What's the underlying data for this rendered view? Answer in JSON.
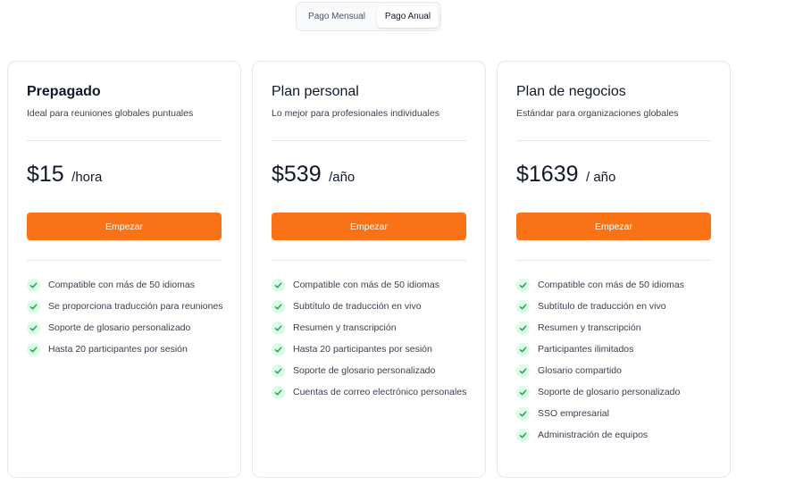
{
  "billing_toggle": {
    "monthly": "Pago Mensual",
    "annual": "Pago Anual",
    "selected": "annual"
  },
  "colors": {
    "accent": "#f97316",
    "check_bg": "#dcfce7",
    "check_icon": "#16a34a"
  },
  "plans": [
    {
      "title": "Prepagado",
      "subtitle": "Ideal para reuniones globales puntuales",
      "price": "$15",
      "unit": "/hora",
      "cta": "Empezar",
      "features": [
        "Compatible con más de 50 idiomas",
        "Se proporciona traducción para reuniones",
        "Soporte de glosario personalizado",
        "Hasta 20 participantes por sesión"
      ]
    },
    {
      "title": "Plan personal",
      "subtitle": "Lo mejor para profesionales individuales",
      "price": "$539",
      "unit": "/año",
      "cta": "Empezar",
      "features": [
        "Compatible con más de 50 idiomas",
        "Subtítulo de traducción en vivo",
        "Resumen y transcripción",
        "Hasta 20 participantes por sesión",
        "Soporte de glosario personalizado",
        "Cuentas de correo electrónico personales"
      ]
    },
    {
      "title": "Plan de negocios",
      "subtitle": "Estándar para organizaciones globales",
      "price": "$1639",
      "unit": "/ año",
      "cta": "Empezar",
      "features": [
        "Compatible con más de 50 idiomas",
        "Subtítulo de traducción en vivo",
        "Resumen y transcripción",
        "Participantes ilimitados",
        "Glosario compartido",
        "Soporte de glosario personalizado",
        "SSO empresarial",
        "Administración de equipos"
      ]
    }
  ]
}
